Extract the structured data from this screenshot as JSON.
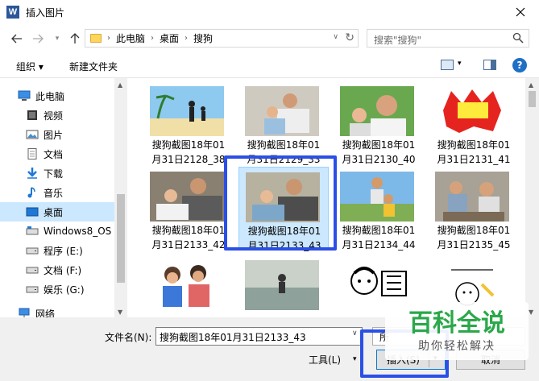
{
  "window": {
    "title": "插入图片",
    "app_icon_letter": "W"
  },
  "breadcrumb": [
    "此电脑",
    "桌面",
    "搜狗"
  ],
  "search": {
    "placeholder": "搜索\"搜狗\""
  },
  "toolbar": {
    "organize": "组织 ▾",
    "new_folder": "新建文件夹",
    "help": "?"
  },
  "nav": [
    {
      "label": "此电脑",
      "icon": "computer-icon"
    },
    {
      "label": "视频",
      "icon": "video-icon"
    },
    {
      "label": "图片",
      "icon": "pictures-icon"
    },
    {
      "label": "文档",
      "icon": "documents-icon"
    },
    {
      "label": "下载",
      "icon": "download-icon"
    },
    {
      "label": "音乐",
      "icon": "music-icon"
    },
    {
      "label": "桌面",
      "icon": "desktop-icon"
    },
    {
      "label": "Windows8_OS",
      "icon": "drive-icon"
    },
    {
      "label": "程序 (E:)",
      "icon": "drive-icon"
    },
    {
      "label": "文档 (F:)",
      "icon": "drive-icon"
    },
    {
      "label": "娱乐 (G:)",
      "icon": "drive-icon"
    },
    {
      "label": "网络",
      "icon": "network-icon"
    }
  ],
  "files": [
    {
      "line1": "搜狗截图18年01",
      "line2": "月31日2128_38"
    },
    {
      "line1": "搜狗截图18年01",
      "line2": "月31日2129_33"
    },
    {
      "line1": "搜狗截图18年01",
      "line2": "月31日2130_40"
    },
    {
      "line1": "搜狗截图18年01",
      "line2": "月31日2131_41"
    },
    {
      "line1": "搜狗截图18年01",
      "line2": "月31日2133_42"
    },
    {
      "line1": "搜狗截图18年01",
      "line2": "月31日2133_43"
    },
    {
      "line1": "搜狗截图18年01",
      "line2": "月31日2134_44"
    },
    {
      "line1": "搜狗截图18年01",
      "line2": "月31日2135_45"
    },
    {
      "line1": "",
      "line2": ""
    },
    {
      "line1": "",
      "line2": ""
    },
    {
      "line1": "",
      "line2": ""
    },
    {
      "line1": "",
      "line2": ""
    }
  ],
  "bottom": {
    "filename_label": "文件名(N):",
    "filename_value": "搜狗截图18年01月31日2133_43",
    "filetype": "所",
    "tools": "工具(L)",
    "insert": "插入(S)",
    "cancel": "取消"
  },
  "watermark": {
    "brand": "百科全说",
    "tagline": "助你轻松解决"
  },
  "colors": {
    "selection": "#cce8ff",
    "highlight": "#2b4fe6",
    "watermark_green": "#2aa84a"
  }
}
